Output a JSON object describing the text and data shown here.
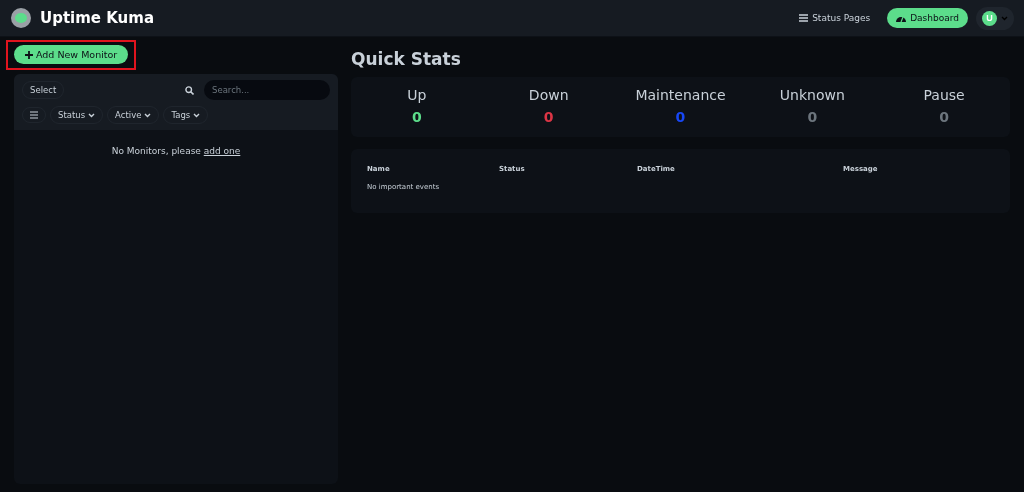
{
  "header": {
    "brand": "Uptime Kuma",
    "nav": [
      {
        "kind": "link",
        "label": "Status Pages",
        "selected": false
      },
      {
        "kind": "pill",
        "label": "Dashboard",
        "selected": true
      }
    ],
    "avatar": "U"
  },
  "add_button": {
    "label": "Add New Monitor",
    "highlighted": true
  },
  "monitor_list": {
    "select_label": "Select",
    "search": {
      "placeholder": "Search..."
    },
    "filters": [
      "Status",
      "Active",
      "Tags"
    ],
    "empty_text": "No Monitors, please ",
    "empty_link": "add one"
  },
  "quick_stats": {
    "title": "Quick Stats",
    "stats": [
      {
        "label": "Up",
        "value": "0",
        "color": "#5cdd8b"
      },
      {
        "label": "Down",
        "value": "0",
        "color": "#dc3545"
      },
      {
        "label": "Maintenance",
        "value": "0",
        "color": "#1747f5"
      },
      {
        "label": "Unknown",
        "value": "0",
        "color": "#6c757d"
      },
      {
        "label": "Pause",
        "value": "0",
        "color": "#6c757d"
      }
    ]
  },
  "events": {
    "columns": [
      "Name",
      "Status",
      "DateTime",
      "Message"
    ],
    "empty_text": "No important events"
  }
}
